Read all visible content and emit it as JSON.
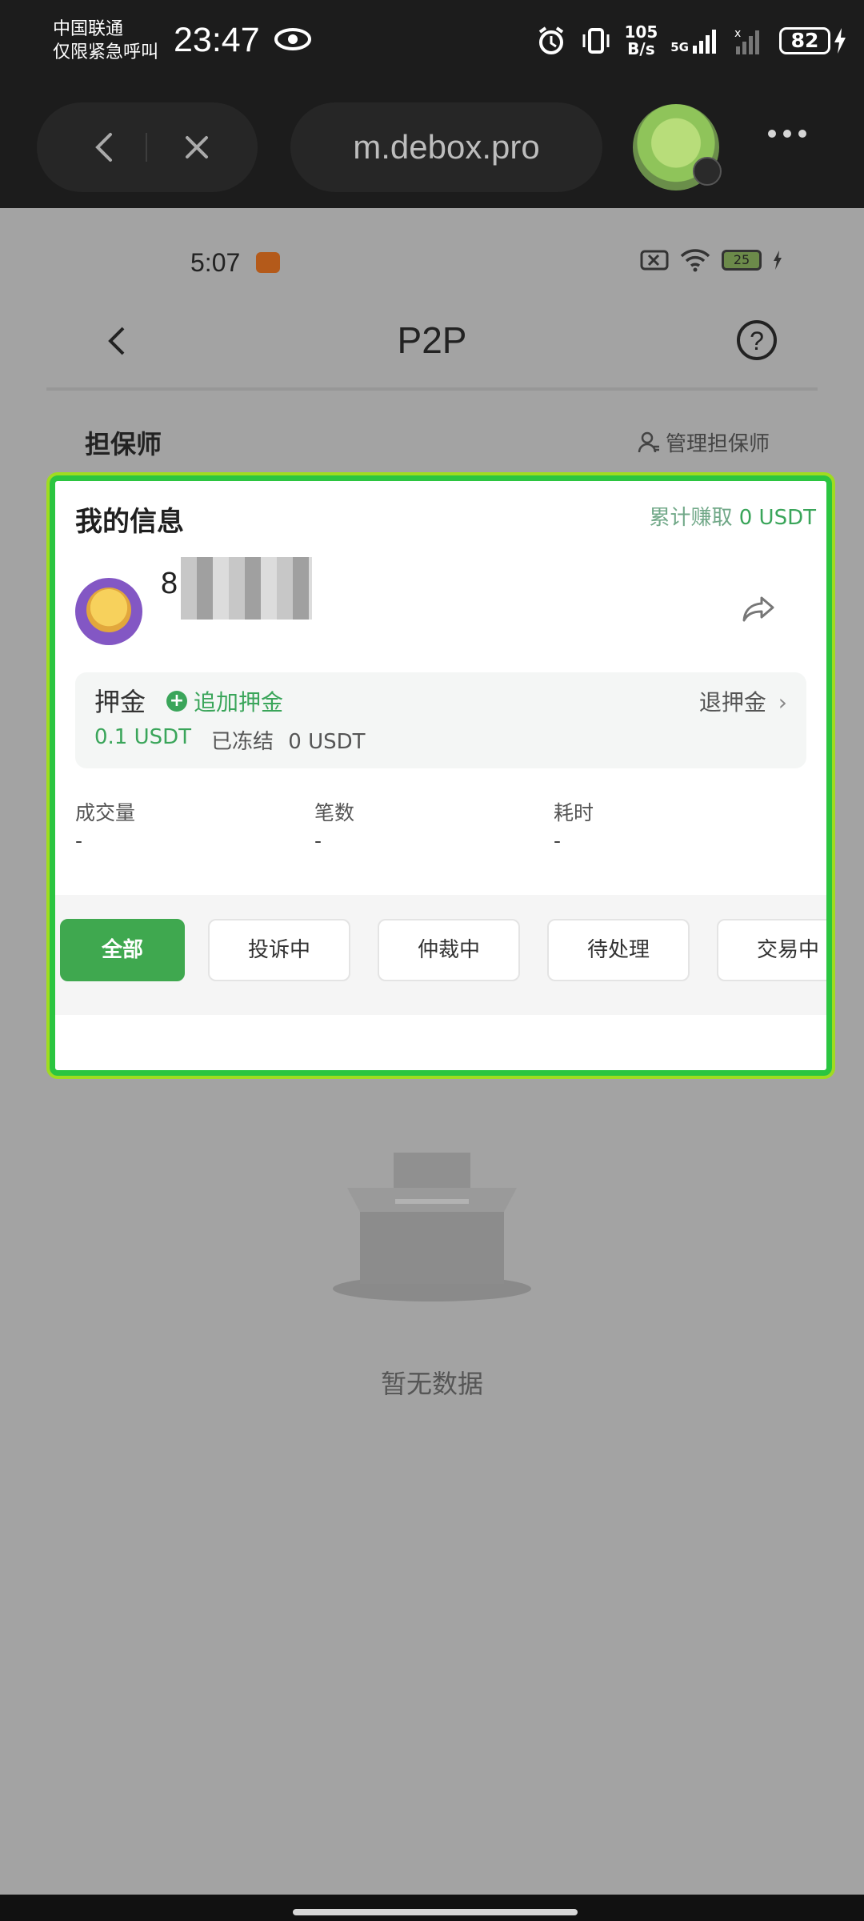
{
  "system_status": {
    "carrier_line1": "中国联通",
    "carrier_line2": "仅限紧急呼叫",
    "time": "23:47",
    "net_speed_value": "105",
    "net_speed_unit": "B/s",
    "network": "5G",
    "battery": "82"
  },
  "browser": {
    "url": "m.debox.pro"
  },
  "inner_status": {
    "time": "5:07",
    "battery": "25"
  },
  "header": {
    "title": "P2P",
    "help": "?"
  },
  "guarantor": {
    "title": "担保师",
    "manage_label": "管理担保师"
  },
  "card": {
    "my_info": "我的信息",
    "earned_label": "累计赚取",
    "earned_value": "0 USDT",
    "username_visible": "8",
    "deposit_label": "押金",
    "add_deposit": "追加押金",
    "refund_deposit": "退押金",
    "deposit_amount": "0.1 USDT",
    "frozen_label": "已冻结",
    "frozen_amount": "0 USDT",
    "stats": [
      {
        "label": "成交量",
        "value": "-"
      },
      {
        "label": "笔数",
        "value": "-"
      },
      {
        "label": "耗时",
        "value": "-"
      }
    ],
    "tabs": [
      "全部",
      "投诉中",
      "仲裁中",
      "待处理",
      "交易中"
    ],
    "active_tab": "全部"
  },
  "empty": {
    "text": "暂无数据"
  },
  "colors": {
    "accent_green": "#3fa84f",
    "highlight_border": "#2bc540"
  }
}
